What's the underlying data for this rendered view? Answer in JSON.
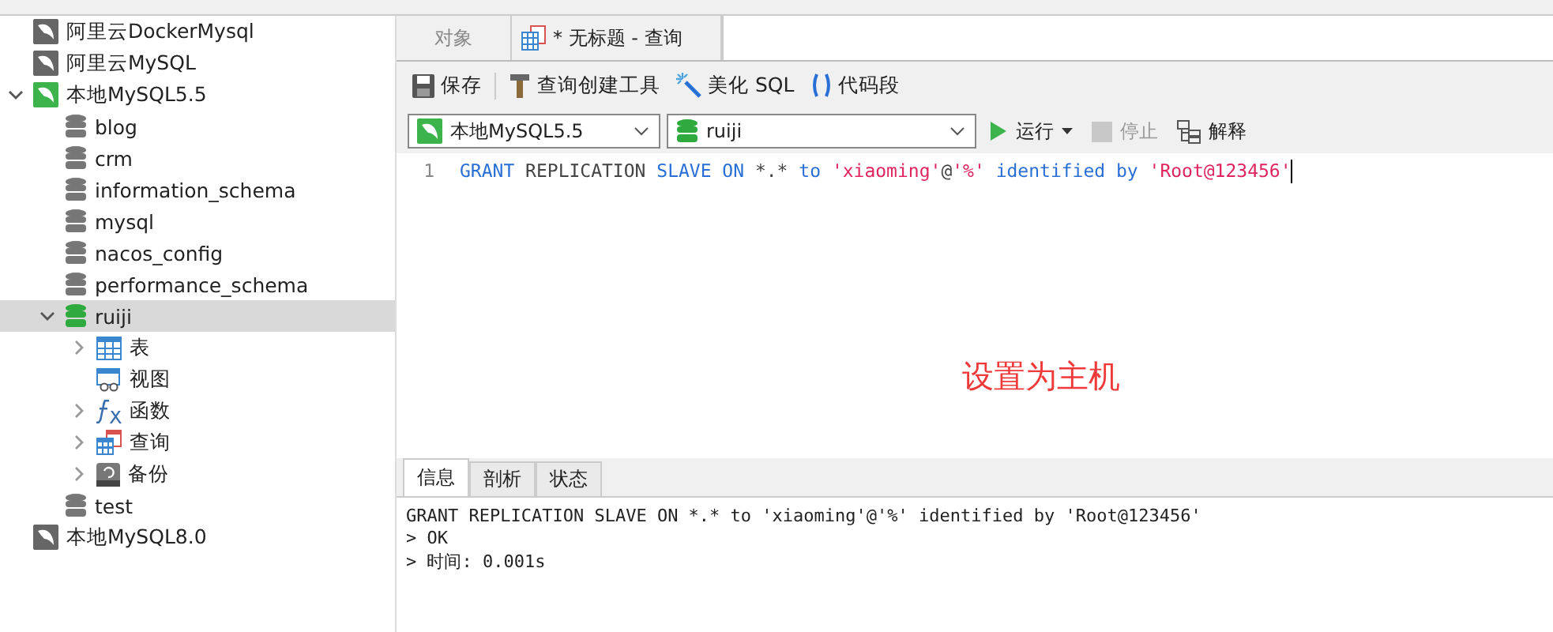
{
  "sidebar": {
    "items": [
      {
        "kind": "connection",
        "label": "阿里云DockerMysql",
        "open": false,
        "expanded": false,
        "selected": false
      },
      {
        "kind": "connection",
        "label": "阿里云MySQL",
        "open": false,
        "expanded": false,
        "selected": false
      },
      {
        "kind": "connection",
        "label": "本地MySQL5.5",
        "open": true,
        "expanded": true,
        "selected": false,
        "children": [
          {
            "kind": "database",
            "label": "blog",
            "open": false,
            "expanded": false,
            "selected": false
          },
          {
            "kind": "database",
            "label": "crm",
            "open": false,
            "expanded": false,
            "selected": false
          },
          {
            "kind": "database",
            "label": "information_schema",
            "open": false,
            "expanded": false,
            "selected": false
          },
          {
            "kind": "database",
            "label": "mysql",
            "open": false,
            "expanded": false,
            "selected": false
          },
          {
            "kind": "database",
            "label": "nacos_config",
            "open": false,
            "expanded": false,
            "selected": false
          },
          {
            "kind": "database",
            "label": "performance_schema",
            "open": false,
            "expanded": false,
            "selected": false
          },
          {
            "kind": "database",
            "label": "ruiji",
            "open": true,
            "expanded": true,
            "selected": true,
            "children": [
              {
                "kind": "table",
                "label": "表",
                "expandable": true
              },
              {
                "kind": "view",
                "label": "视图",
                "expandable": false
              },
              {
                "kind": "function",
                "label": "函数",
                "expandable": true
              },
              {
                "kind": "query",
                "label": "查询",
                "expandable": true
              },
              {
                "kind": "backup",
                "label": "备份",
                "expandable": true
              }
            ]
          },
          {
            "kind": "database",
            "label": "test",
            "open": false,
            "expanded": false,
            "selected": false
          }
        ]
      },
      {
        "kind": "connection",
        "label": "本地MySQL8.0",
        "open": false,
        "expanded": false,
        "selected": false
      }
    ]
  },
  "tabs": [
    {
      "label": "对象",
      "selected": false,
      "kind": "plain"
    },
    {
      "label": "* 无标题 - 查询",
      "selected": true,
      "kind": "query"
    }
  ],
  "toolbar": [
    {
      "kind": "save",
      "label": "保存"
    },
    {
      "kind": "builder",
      "label": "查询创建工具"
    },
    {
      "kind": "beautify",
      "label": "美化 SQL"
    },
    {
      "kind": "snippet",
      "label": "代码段"
    }
  ],
  "connection_select": {
    "value": "本地MySQL5.5"
  },
  "database_select": {
    "value": "ruiji"
  },
  "actions": [
    {
      "kind": "run",
      "label": "运行",
      "disabled": false
    },
    {
      "kind": "stop",
      "label": "停止",
      "disabled": true
    },
    {
      "kind": "explain",
      "label": "解释",
      "disabled": false
    }
  ],
  "editor": {
    "lines": [
      {
        "number": "1",
        "tokens": [
          {
            "kind": "keyword",
            "text": "GRANT"
          },
          {
            "kind": "plain",
            "text": " REPLICATION "
          },
          {
            "kind": "keyword",
            "text": "SLAVE ON"
          },
          {
            "kind": "plain",
            "text": " *.* "
          },
          {
            "kind": "keyword",
            "text": "to"
          },
          {
            "kind": "string",
            "text": " 'xiaoming'"
          },
          {
            "kind": "plain",
            "text": "@"
          },
          {
            "kind": "string",
            "text": "'%'"
          },
          {
            "kind": "keyword",
            "text": " identified by"
          },
          {
            "kind": "string",
            "text": " 'Root@123456'"
          }
        ]
      }
    ],
    "annotation": "设置为主机"
  },
  "result_tabs": [
    {
      "label": "信息",
      "selected": true
    },
    {
      "label": "剖析",
      "selected": false
    },
    {
      "label": "状态",
      "selected": false
    }
  ],
  "output": [
    "GRANT REPLICATION SLAVE ON *.* to 'xiaoming'@'%' identified by 'Root@123456'",
    "> OK",
    "> 时间: 0.001s"
  ]
}
